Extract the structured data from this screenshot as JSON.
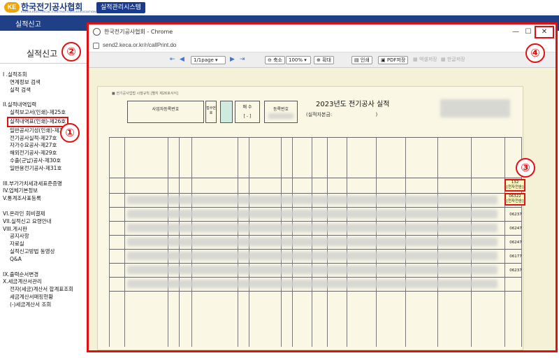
{
  "header": {
    "logo_mark": "KE",
    "logo_text": "한국전기공사협회",
    "logo_sub": "KOREA ELECTRICAL CONTRACTORS ASSOCIATION",
    "system_badge": "실적관리시스템",
    "nav_item": "실적신고"
  },
  "sidebar": {
    "title": "실적신고",
    "menu": [
      {
        "type": "sec",
        "label": "I .실적조회"
      },
      {
        "type": "sub",
        "label": "연계정보 검색"
      },
      {
        "type": "sub",
        "label": "실적 검색"
      },
      {
        "type": "gap"
      },
      {
        "type": "sec",
        "label": "II.실적내역입력"
      },
      {
        "type": "sub",
        "label": "실적보고서(인쇄)-제25호"
      },
      {
        "type": "sub-hl",
        "label": "실적내역표(인쇄)-제26호"
      },
      {
        "type": "sub",
        "label": "일반공사기성(인쇄)-제31호"
      },
      {
        "type": "sub",
        "label": "전기공사실적-제27호"
      },
      {
        "type": "sub",
        "label": "자가수요공사-제27호"
      },
      {
        "type": "sub",
        "label": "해외전기공사-제29호"
      },
      {
        "type": "sub",
        "label": "수출(군납)공사-제30호"
      },
      {
        "type": "sub",
        "label": "일반용전기공사-제31호"
      },
      {
        "type": "gap"
      },
      {
        "type": "sec",
        "label": "III.부가가치세과세표준증명"
      },
      {
        "type": "sec",
        "label": "IV.업체기본정보"
      },
      {
        "type": "sec",
        "label": "V.통계조사표등록"
      },
      {
        "type": "gap"
      },
      {
        "type": "sec",
        "label": "VI.온라인 회비결제"
      },
      {
        "type": "sec",
        "label": "VII.실적신고 요령안내"
      },
      {
        "type": "sec",
        "label": "VIII.게시판"
      },
      {
        "type": "sub",
        "label": "공지사항"
      },
      {
        "type": "sub",
        "label": "자료실"
      },
      {
        "type": "sub",
        "label": "실적신고방법 동영상"
      },
      {
        "type": "sub",
        "label": "Q&A"
      },
      {
        "type": "gap"
      },
      {
        "type": "sec",
        "label": "IX.출력순서변경"
      },
      {
        "type": "sec",
        "label": "X.세금계산서관리"
      },
      {
        "type": "sub",
        "label": "전자(세금)계산서 합계표조회"
      },
      {
        "type": "sub",
        "label": "세금계산서매핑현황"
      },
      {
        "type": "sub",
        "label": "(-)세금계산서 조회"
      }
    ]
  },
  "popup": {
    "window_title": "한국전기공사협회 - Chrome",
    "url": "send2.keca.or.kr/r/callPrint.do",
    "toolbar": {
      "page_select": "1/1page",
      "zoom_out": "축소",
      "zoom_value": "100%",
      "zoom_in": "확대",
      "print": "인쇄",
      "pdf": "PDF저장",
      "excel": "엑셀저장",
      "hwp": "한글저장"
    },
    "document": {
      "small_header": "■ 전기공사업법 시행규칙 [별지 제26호서식]",
      "title": "2023년도 전기공사 실적",
      "reg_label": "사업자등록번호",
      "reception_label": "접수번호",
      "copies_label": "매 수",
      "copies_value": "[ - ]",
      "reg_no_label": "등록번호",
      "reporter_label": "(실적자본금:",
      "reporter_end": ")",
      "codes": [
        "06237",
        "06247",
        "06247",
        "06177",
        "06237"
      ],
      "highlight_codes": [
        {
          "code": "132",
          "label": "[전자전송]"
        },
        {
          "code": "06322",
          "label": "[전자전송]"
        }
      ]
    }
  },
  "annotations": [
    "①",
    "②",
    "③",
    "④"
  ]
}
